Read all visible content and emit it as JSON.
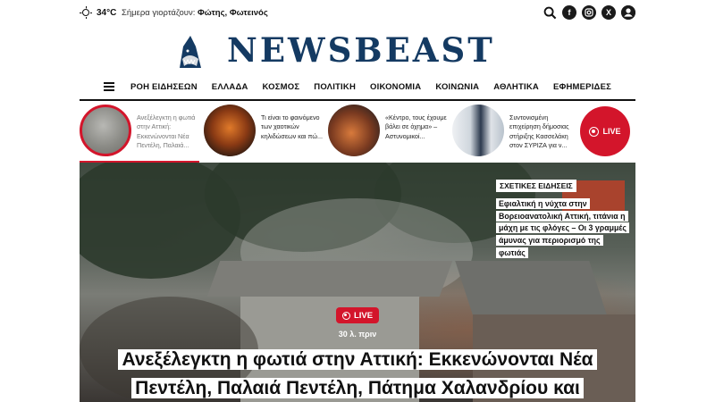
{
  "topbar": {
    "temperature": "34°C",
    "nameday_label": "Σήμερα γιορτάζουν:",
    "nameday_names": "Φώτης, Φωτεινός",
    "social_icons": [
      "search-icon",
      "facebook-icon",
      "instagram-icon",
      "x-icon",
      "user-icon"
    ]
  },
  "logo": {
    "text": "NEWSBEAST"
  },
  "nav": {
    "items": [
      "ΡΟΗ ΕΙΔΗΣΕΩΝ",
      "ΕΛΛΑΔΑ",
      "ΚΟΣΜΟΣ",
      "ΠΟΛΙΤΙΚΗ",
      "ΟΙΚΟΝΟΜΙΑ",
      "ΚΟΙΝΩΝΙΑ",
      "ΑΘΛΗΤΙΚΑ",
      "ΕΦΗΜΕΡΙΔΕΣ"
    ]
  },
  "stories": [
    {
      "text": "Ανεξέλεγκτη η φωτιά στην Αττική: Εκκενώνονται Νέα Πεντέλη, Παλαιά...",
      "active": true
    },
    {
      "text": "Τι είναι το φαινόμενο των χαοτικών κηλιδώσεων και πώ...",
      "active": false
    },
    {
      "text": "«Κέντρο, τους έχουμε βάλει σε όχημα» – Αστυνομικοί...",
      "active": false
    },
    {
      "text": "Συντονισμένη επιχείρηση δήμοσιας στήριξης Κασσελάκη στον ΣΥΡΙΖΑ για ν...",
      "active": false
    }
  ],
  "live_story_label": "LIVE",
  "hero": {
    "related_tag": "ΣΧΕΤΙΚΕΣ ΕΙΔΗΣΕΙΣ",
    "related_text": "Εφιαλτική η νύχτα στην Βορειοανατολική Αττική, τιτάνια η μάχη με τις φλόγες – Οι 3 γραμμές άμυνας για περιορισμό της φωτιάς",
    "live_label": "LIVE",
    "time": "30 λ. πριν",
    "headline": "Ανεξέλεγκτη η φωτιά στην Αττική: Εκκενώνονται Νέα Πεντέλη, Παλαιά Πεντέλη, Πάτημα Χαλανδρίου και"
  },
  "colors": {
    "brand_navy": "#143a62",
    "live_red": "#d3152b"
  }
}
